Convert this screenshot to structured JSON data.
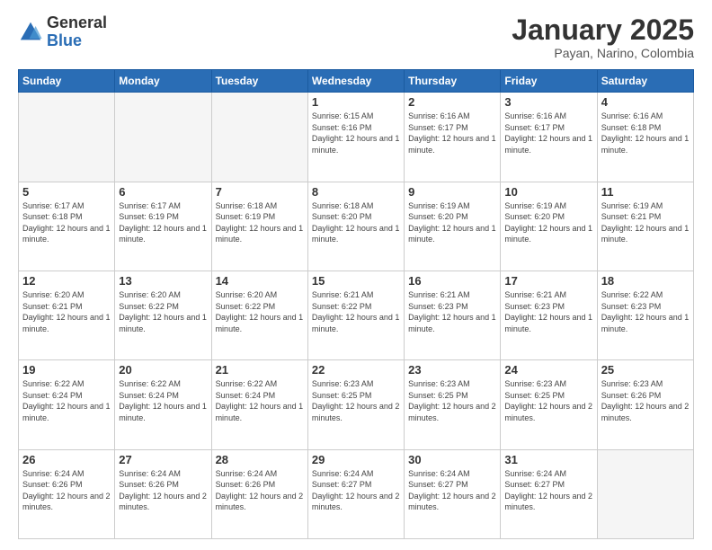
{
  "header": {
    "logo_general": "General",
    "logo_blue": "Blue",
    "title": "January 2025",
    "location": "Payan, Narino, Colombia"
  },
  "days_of_week": [
    "Sunday",
    "Monday",
    "Tuesday",
    "Wednesday",
    "Thursday",
    "Friday",
    "Saturday"
  ],
  "weeks": [
    [
      {
        "day": "",
        "info": ""
      },
      {
        "day": "",
        "info": ""
      },
      {
        "day": "",
        "info": ""
      },
      {
        "day": "1",
        "info": "Sunrise: 6:15 AM\nSunset: 6:16 PM\nDaylight: 12 hours and 1 minute."
      },
      {
        "day": "2",
        "info": "Sunrise: 6:16 AM\nSunset: 6:17 PM\nDaylight: 12 hours and 1 minute."
      },
      {
        "day": "3",
        "info": "Sunrise: 6:16 AM\nSunset: 6:17 PM\nDaylight: 12 hours and 1 minute."
      },
      {
        "day": "4",
        "info": "Sunrise: 6:16 AM\nSunset: 6:18 PM\nDaylight: 12 hours and 1 minute."
      }
    ],
    [
      {
        "day": "5",
        "info": "Sunrise: 6:17 AM\nSunset: 6:18 PM\nDaylight: 12 hours and 1 minute."
      },
      {
        "day": "6",
        "info": "Sunrise: 6:17 AM\nSunset: 6:19 PM\nDaylight: 12 hours and 1 minute."
      },
      {
        "day": "7",
        "info": "Sunrise: 6:18 AM\nSunset: 6:19 PM\nDaylight: 12 hours and 1 minute."
      },
      {
        "day": "8",
        "info": "Sunrise: 6:18 AM\nSunset: 6:20 PM\nDaylight: 12 hours and 1 minute."
      },
      {
        "day": "9",
        "info": "Sunrise: 6:19 AM\nSunset: 6:20 PM\nDaylight: 12 hours and 1 minute."
      },
      {
        "day": "10",
        "info": "Sunrise: 6:19 AM\nSunset: 6:20 PM\nDaylight: 12 hours and 1 minute."
      },
      {
        "day": "11",
        "info": "Sunrise: 6:19 AM\nSunset: 6:21 PM\nDaylight: 12 hours and 1 minute."
      }
    ],
    [
      {
        "day": "12",
        "info": "Sunrise: 6:20 AM\nSunset: 6:21 PM\nDaylight: 12 hours and 1 minute."
      },
      {
        "day": "13",
        "info": "Sunrise: 6:20 AM\nSunset: 6:22 PM\nDaylight: 12 hours and 1 minute."
      },
      {
        "day": "14",
        "info": "Sunrise: 6:20 AM\nSunset: 6:22 PM\nDaylight: 12 hours and 1 minute."
      },
      {
        "day": "15",
        "info": "Sunrise: 6:21 AM\nSunset: 6:22 PM\nDaylight: 12 hours and 1 minute."
      },
      {
        "day": "16",
        "info": "Sunrise: 6:21 AM\nSunset: 6:23 PM\nDaylight: 12 hours and 1 minute."
      },
      {
        "day": "17",
        "info": "Sunrise: 6:21 AM\nSunset: 6:23 PM\nDaylight: 12 hours and 1 minute."
      },
      {
        "day": "18",
        "info": "Sunrise: 6:22 AM\nSunset: 6:23 PM\nDaylight: 12 hours and 1 minute."
      }
    ],
    [
      {
        "day": "19",
        "info": "Sunrise: 6:22 AM\nSunset: 6:24 PM\nDaylight: 12 hours and 1 minute."
      },
      {
        "day": "20",
        "info": "Sunrise: 6:22 AM\nSunset: 6:24 PM\nDaylight: 12 hours and 1 minute."
      },
      {
        "day": "21",
        "info": "Sunrise: 6:22 AM\nSunset: 6:24 PM\nDaylight: 12 hours and 1 minute."
      },
      {
        "day": "22",
        "info": "Sunrise: 6:23 AM\nSunset: 6:25 PM\nDaylight: 12 hours and 2 minutes."
      },
      {
        "day": "23",
        "info": "Sunrise: 6:23 AM\nSunset: 6:25 PM\nDaylight: 12 hours and 2 minutes."
      },
      {
        "day": "24",
        "info": "Sunrise: 6:23 AM\nSunset: 6:25 PM\nDaylight: 12 hours and 2 minutes."
      },
      {
        "day": "25",
        "info": "Sunrise: 6:23 AM\nSunset: 6:26 PM\nDaylight: 12 hours and 2 minutes."
      }
    ],
    [
      {
        "day": "26",
        "info": "Sunrise: 6:24 AM\nSunset: 6:26 PM\nDaylight: 12 hours and 2 minutes."
      },
      {
        "day": "27",
        "info": "Sunrise: 6:24 AM\nSunset: 6:26 PM\nDaylight: 12 hours and 2 minutes."
      },
      {
        "day": "28",
        "info": "Sunrise: 6:24 AM\nSunset: 6:26 PM\nDaylight: 12 hours and 2 minutes."
      },
      {
        "day": "29",
        "info": "Sunrise: 6:24 AM\nSunset: 6:27 PM\nDaylight: 12 hours and 2 minutes."
      },
      {
        "day": "30",
        "info": "Sunrise: 6:24 AM\nSunset: 6:27 PM\nDaylight: 12 hours and 2 minutes."
      },
      {
        "day": "31",
        "info": "Sunrise: 6:24 AM\nSunset: 6:27 PM\nDaylight: 12 hours and 2 minutes."
      },
      {
        "day": "",
        "info": ""
      }
    ]
  ]
}
